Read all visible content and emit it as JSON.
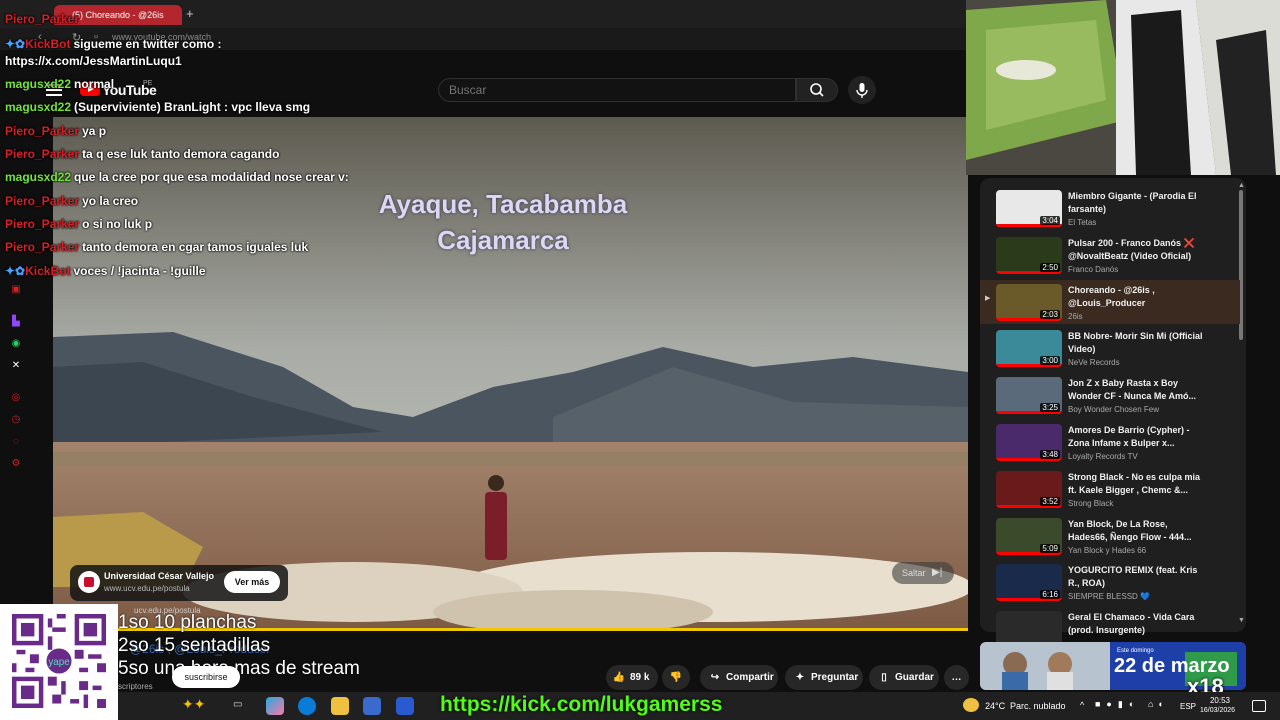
{
  "browser": {
    "tab_title": "(5) Choreando - @26is",
    "new_tab": "+",
    "url": "www.youtube.com/watch"
  },
  "youtube": {
    "logo": "YouTube",
    "region": "PE",
    "search_placeholder": "Buscar"
  },
  "chat": [
    {
      "user": "Piero_Parker",
      "msg": "",
      "color": "red",
      "bot": false
    },
    {
      "user": "KickBot",
      "msg": "sigueme en twitter como :",
      "color": "red",
      "bot": true
    },
    {
      "user": "",
      "msg": "https://x.com/JessMartinLuqu1",
      "color": "none",
      "bot": false
    },
    {
      "user": "magusxd22",
      "msg": "normal",
      "color": "green",
      "bot": false
    },
    {
      "user": "magusxd22",
      "msg": "(Superviviente) BranLight : vpc lleva smg",
      "color": "green",
      "bot": false
    },
    {
      "user": "Piero_Parker",
      "msg": "ya p",
      "color": "red",
      "bot": false
    },
    {
      "user": "Piero_Parker",
      "msg": "ta q ese luk tanto demora cagando",
      "color": "red",
      "bot": false
    },
    {
      "user": "magusxd22",
      "msg": "que la cree por que esa modalidad nose crear v:",
      "color": "green",
      "bot": false
    },
    {
      "user": "Piero_Parker",
      "msg": "yo la creo",
      "color": "red",
      "bot": false
    },
    {
      "user": "Piero_Parker",
      "msg": "o si no luk p",
      "color": "red",
      "bot": false
    },
    {
      "user": "Piero_Parker",
      "msg": "tanto demora en cgar tamos iguales luk",
      "color": "red",
      "bot": false
    },
    {
      "user": "KickBot",
      "msg": "voces / !jacinta - !guille",
      "color": "red",
      "bot": true
    }
  ],
  "video": {
    "title_line1": "Ayaque, Tacabamba",
    "title_line2": "Cajamarca",
    "ad_name": "Universidad César Vallejo",
    "ad_url": "www.ucv.edu.pe/postula",
    "ad_url_small": "ucv.edu.pe/postula",
    "ad_cta": "Ver más",
    "skip": "Saltar",
    "progress_fraction": 1.0
  },
  "overlay_goals": [
    "1so 10 planchas",
    "2so 15 sentadillas",
    "5so una hora mas de stream"
  ],
  "below_video": {
    "channel_ghost": "@26is , @Louis_Producer",
    "subscribers": "scriptores",
    "subscribe": "suscribirse",
    "likes": "89 k",
    "share": "Compartir",
    "ask": "Preguntar",
    "save": "Guardar",
    "more": "…"
  },
  "qr": {
    "center_label": "yape"
  },
  "playlist": [
    {
      "title": "Miembro Gigante - (Parodia El farsante)",
      "channel": "El Tetas",
      "duration": "3:04",
      "active": false,
      "thumb": "#e8e8e8"
    },
    {
      "title": "Pulsar 200 - Franco Danós ❌ @NovaltBeatz (Video Oficial)",
      "channel": "Franco Danós",
      "duration": "2:50",
      "active": false,
      "thumb": "#2b3a1a"
    },
    {
      "title": "Choreando - @26is , @Louis_Producer",
      "channel": "26is",
      "duration": "2:03",
      "active": true,
      "thumb": "#6a5a2a"
    },
    {
      "title": "BB Nobre- Morir Sin Mi (Official Video)",
      "channel": "NeVe Records",
      "duration": "3:00",
      "active": false,
      "thumb": "#3a8a9a"
    },
    {
      "title": "Jon Z x Baby Rasta x Boy Wonder CF - Nunca Me Amó...",
      "channel": "Boy Wonder Chosen Few",
      "duration": "3:25",
      "active": false,
      "thumb": "#5a6a7a"
    },
    {
      "title": "Amores De Barrio (Cypher) - Zona Infame x Bulper x...",
      "channel": "Loyalty Records TV",
      "duration": "3:48",
      "active": false,
      "thumb": "#4a2a6a"
    },
    {
      "title": "Strong Black - No es culpa mia ft. Kaele Bigger , Chemc &...",
      "channel": "Strong Black",
      "duration": "3:52",
      "active": false,
      "thumb": "#6a1a1a"
    },
    {
      "title": "Yan Block, De La Rose, Hades66, Ñengo Flow - 444...",
      "channel": "Yan Block y Hades 66",
      "duration": "5:09",
      "active": false,
      "thumb": "#3a4a2a"
    },
    {
      "title": "YOGURCITO REMIX (feat. Kris R., ROA)",
      "channel": "SIEMPRE BLESSD 💙",
      "duration": "6:16",
      "active": false,
      "thumb": "#1a2a4a"
    },
    {
      "title": "Geral El Chamaco - Vida Cara (prod. Insurgente)",
      "channel": "",
      "duration": "",
      "active": false,
      "thumb": "#2a2a2a"
    }
  ],
  "promo": {
    "date": "22 de marzo",
    "date_top": "Este domingo"
  },
  "stream_overlay": {
    "age": "x18",
    "kick_url": "https://kick.com/lukgamerss"
  },
  "taskbar": {
    "temp": "24°C",
    "weather": "Parc. nublado",
    "lang": "ESP",
    "time": "20:53",
    "date": "16/03/2026"
  }
}
